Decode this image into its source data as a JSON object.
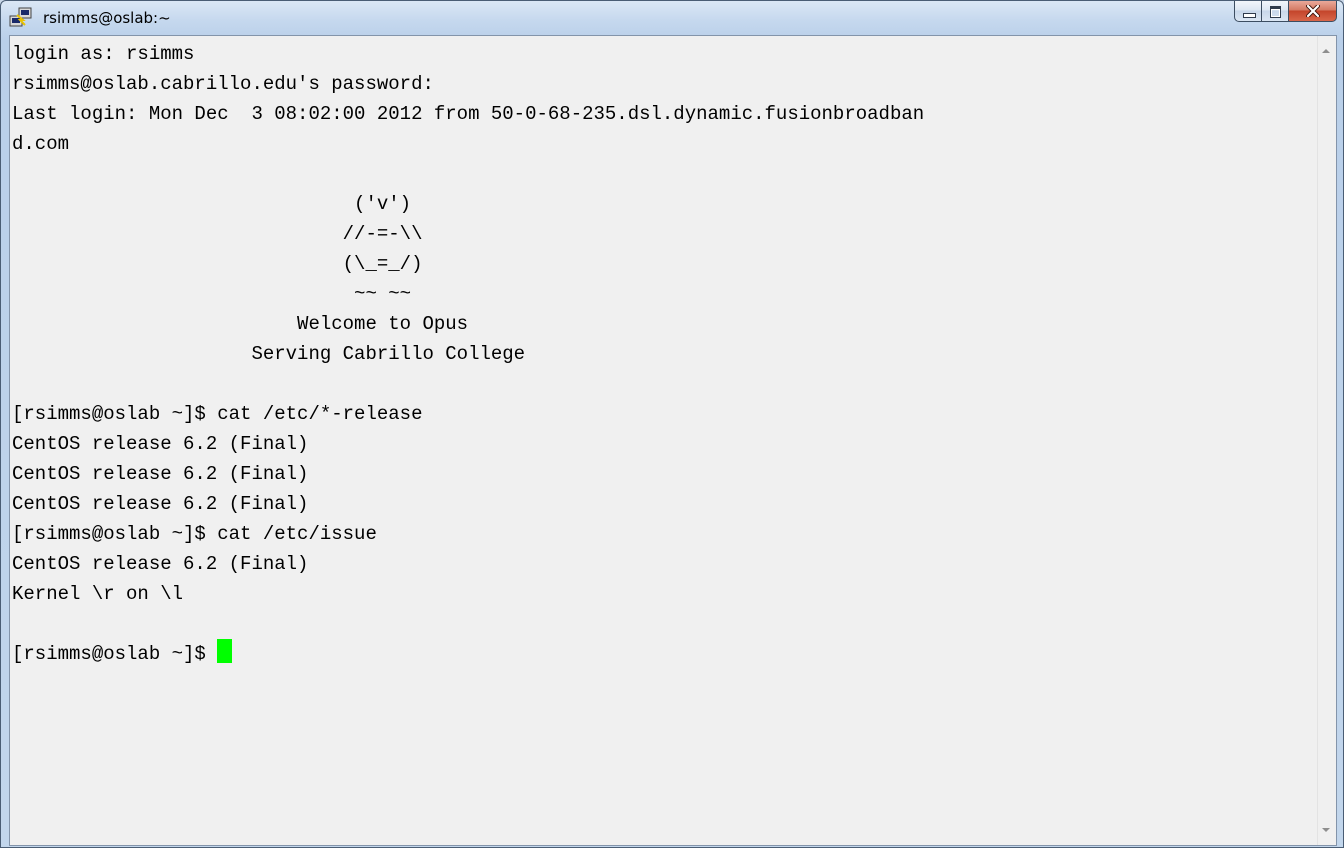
{
  "window": {
    "title": "rsimms@oslab:~",
    "icon": "putty-terminal-icon"
  },
  "controls": {
    "minimize": "minimize",
    "maximize": "maximize",
    "close": "x"
  },
  "terminal": {
    "lines": [
      "login as: rsimms",
      "rsimms@oslab.cabrillo.edu's password:",
      "Last login: Mon Dec  3 08:02:00 2012 from 50-0-68-235.dsl.dynamic.fusionbroadban",
      "d.com",
      "",
      "                              ('v')",
      "                             //-=-\\\\",
      "                             (\\_=_/)",
      "                              ~~ ~~",
      "                         Welcome to Opus",
      "                     Serving Cabrillo College",
      "",
      "[rsimms@oslab ~]$ cat /etc/*-release",
      "CentOS release 6.2 (Final)",
      "CentOS release 6.2 (Final)",
      "CentOS release 6.2 (Final)",
      "[rsimms@oslab ~]$ cat /etc/issue",
      "CentOS release 6.2 (Final)",
      "Kernel \\r on \\l",
      "",
      "[rsimms@oslab ~]$ "
    ],
    "cursor_color": "#00ff00"
  }
}
